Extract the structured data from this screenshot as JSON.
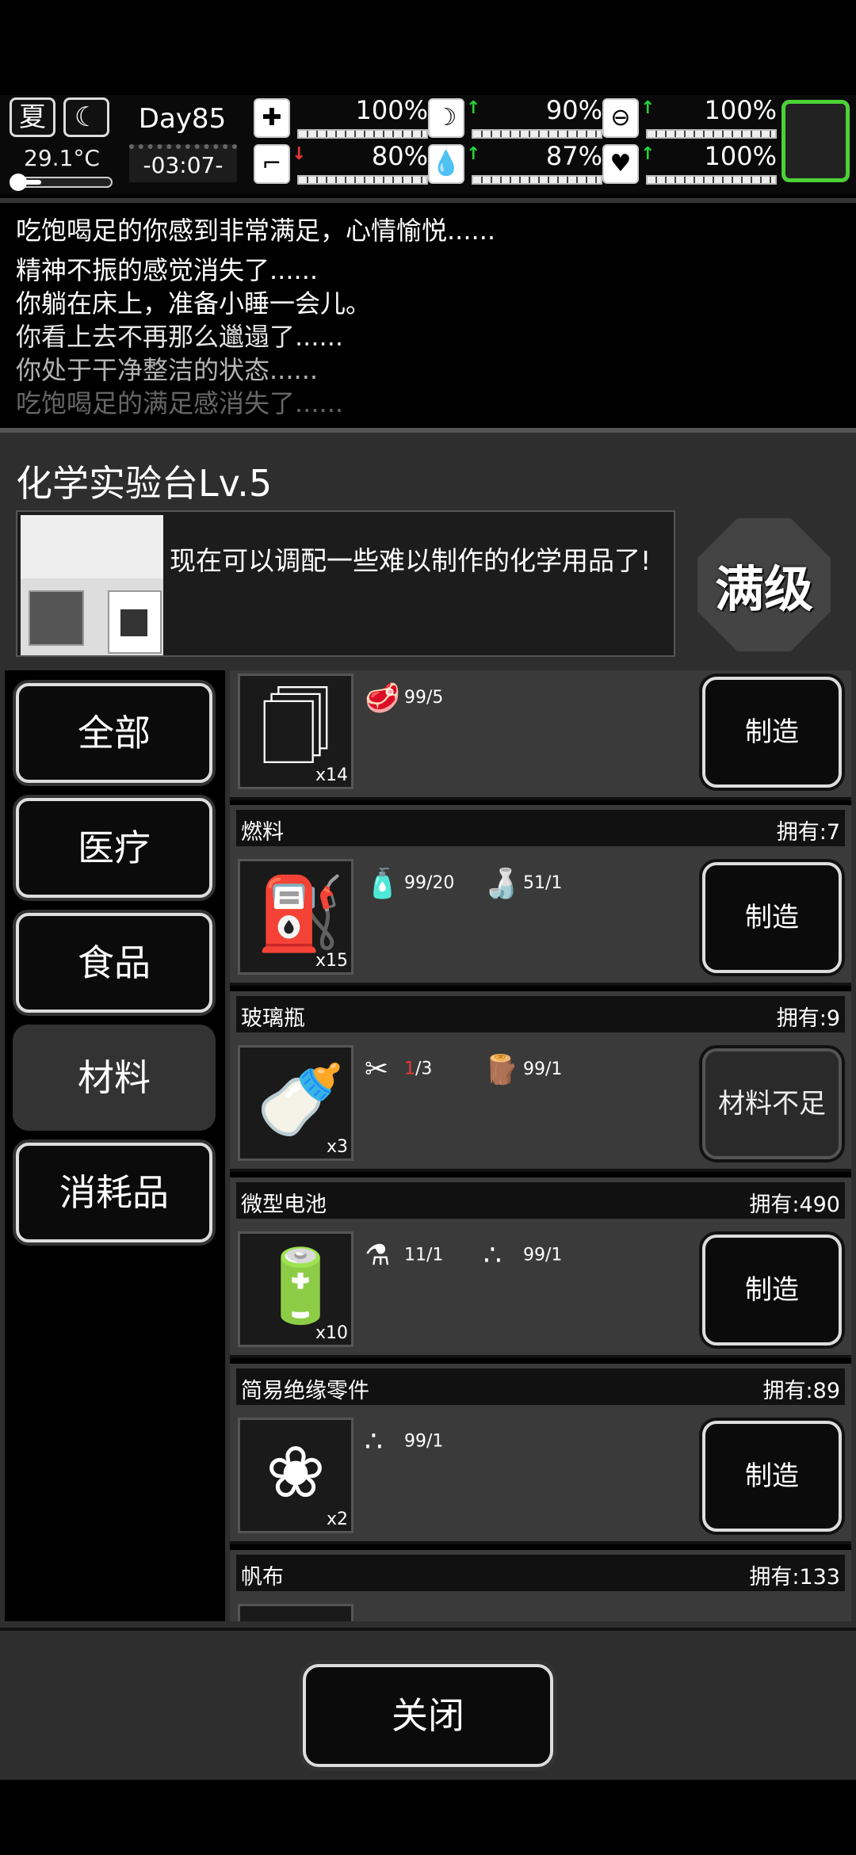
{
  "hud": {
    "season": "夏",
    "temperature": "29.1°C",
    "day": "Day85",
    "time": "-03:07-",
    "stats": [
      {
        "name": "health",
        "icon": "medkit-icon",
        "value": "100%",
        "trend": ""
      },
      {
        "name": "hunger",
        "icon": "stomach-icon",
        "value": "90%",
        "trend": "up"
      },
      {
        "name": "mood",
        "icon": "pill-icon",
        "value": "100%",
        "trend": "up"
      },
      {
        "name": "stamina",
        "icon": "leg-icon",
        "value": "80%",
        "trend": "down"
      },
      {
        "name": "thirst",
        "icon": "water-drop-icon",
        "value": "87%",
        "trend": "up"
      },
      {
        "name": "heart",
        "icon": "heart-icon",
        "value": "100%",
        "trend": "up"
      }
    ],
    "colors": {
      "up": "#29d13a",
      "down": "#e53935",
      "menu_border": "#4cd137"
    }
  },
  "log": {
    "lines": [
      "吃饱喝足的你感到非常满足，心情愉悦......",
      "精神不振的感觉消失了......",
      "你躺在床上，准备小睡一会儿。",
      "你看上去不再那么邋遢了......",
      "你处于干净整洁的状态......",
      "吃饱喝足的满足感消失了......"
    ]
  },
  "bench": {
    "title": "化学实验台Lv.5",
    "description": "现在可以调配一些难以制作的化学用品了!",
    "max_level": "满级"
  },
  "categories": [
    {
      "label": "全部",
      "active": false
    },
    {
      "label": "医疗",
      "active": false
    },
    {
      "label": "食品",
      "active": false
    },
    {
      "label": "材料",
      "active": true
    },
    {
      "label": "消耗品",
      "active": false
    }
  ],
  "recipes": [
    {
      "name": "",
      "owned": "",
      "icon": "flour-sack-icon",
      "count": "x14",
      "materials": [
        {
          "icon": "meat-icon",
          "have": "99",
          "need": "/5"
        }
      ],
      "button": "制造",
      "enabled": true
    },
    {
      "name": "燃料",
      "owned": "拥有:7",
      "icon": "fuel-can-icon",
      "count": "x15",
      "materials": [
        {
          "icon": "spray-bottle-icon",
          "have": "99",
          "need": "/20"
        },
        {
          "icon": "bottle-icon",
          "have": "51",
          "need": "/1"
        }
      ],
      "button": "制造",
      "enabled": true
    },
    {
      "name": "玻璃瓶",
      "owned": "拥有:9",
      "icon": "glass-bottle-icon",
      "count": "x3",
      "materials": [
        {
          "icon": "glass-shard-icon",
          "have": "1",
          "need": "/3",
          "short": true
        },
        {
          "icon": "wood-log-icon",
          "have": "99",
          "need": "/1"
        }
      ],
      "button": "材料不足",
      "enabled": false
    },
    {
      "name": "微型电池",
      "owned": "拥有:490",
      "icon": "battery-icon",
      "count": "x10",
      "materials": [
        {
          "icon": "flask-icon",
          "have": "11",
          "need": "/1"
        },
        {
          "icon": "powder-icon",
          "have": "99",
          "need": "/1"
        }
      ],
      "button": "制造",
      "enabled": true
    },
    {
      "name": "简易绝缘零件",
      "owned": "拥有:89",
      "icon": "insulator-icon",
      "count": "x2",
      "materials": [
        {
          "icon": "powder-icon",
          "have": "99",
          "need": "/1"
        }
      ],
      "button": "制造",
      "enabled": true
    },
    {
      "name": "帆布",
      "owned": "拥有:133",
      "icon": "canvas-icon",
      "count": "",
      "materials": [],
      "button": "",
      "enabled": true
    }
  ],
  "footer": {
    "close": "关闭"
  }
}
